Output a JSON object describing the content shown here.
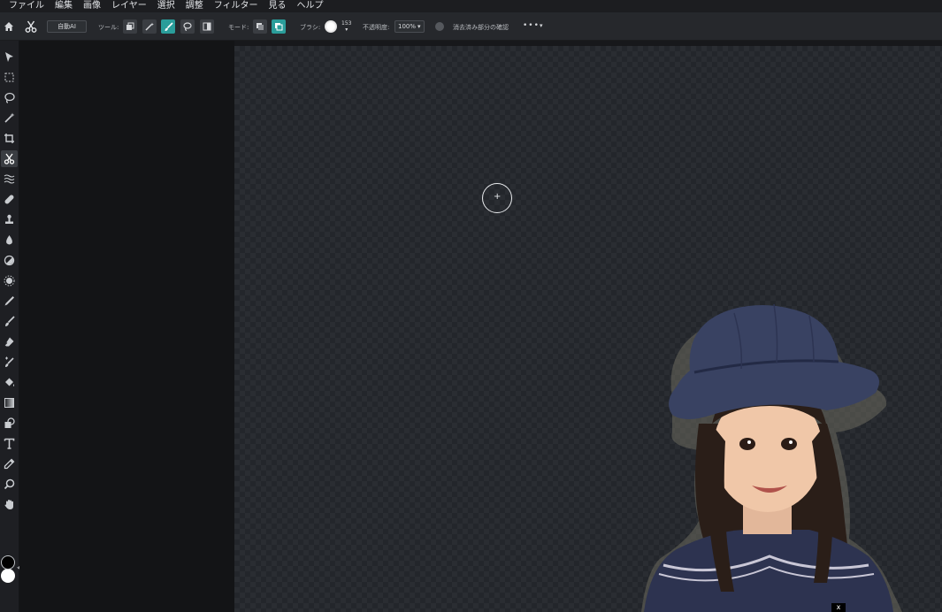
{
  "menu": [
    "ファイル",
    "編集",
    "画像",
    "レイヤー",
    "選択",
    "調整",
    "フィルター",
    "見る",
    "ヘルプ"
  ],
  "options": {
    "auto_label": "自動AI",
    "tool_label": "ツール:",
    "mode_label": "モード:",
    "brush_label": "ブラシ:",
    "brush_size": "153",
    "opacity_label": "不透明度:",
    "opacity_value": "100%",
    "show_removed_label": "消去済み部分の確認",
    "more_label": "•••"
  },
  "toolbar": {
    "active_tool": "cutout-tool",
    "foreground_color": "#000000",
    "background_color": "#ffffff"
  },
  "canvas": {
    "close_label": "x"
  },
  "colors": {
    "accent": "#2a9d9a",
    "panel": "#26282c",
    "workspace": "#131416"
  }
}
